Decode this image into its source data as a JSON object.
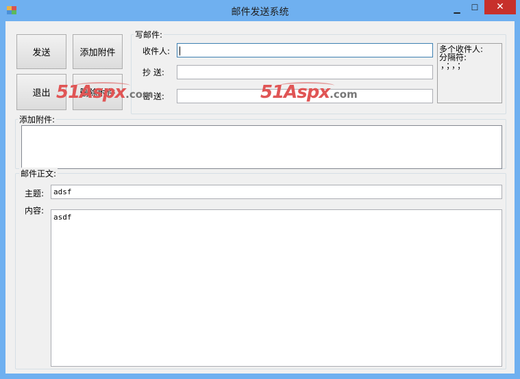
{
  "window": {
    "title": "邮件发送系统",
    "min_glyph": "▁",
    "max_glyph": "☐",
    "close_glyph": "✕"
  },
  "buttons": {
    "send": "发送",
    "add_attachment": "添加附件",
    "exit": "退出",
    "delete_attachment": "删除附件"
  },
  "compose": {
    "legend": "写邮件:",
    "to_label": "收件人:",
    "to_value": "",
    "cc_label": "抄 送:",
    "cc_value": "",
    "bcc_label": "密 送:",
    "bcc_value": "",
    "hint_line1": "多个收件人:",
    "hint_line2": "分隔符:",
    "hint_line3": "，；，；"
  },
  "attachments": {
    "legend": "添加附件:"
  },
  "body": {
    "legend": "邮件正文:",
    "subject_label": "主题:",
    "subject_value": "adsf",
    "content_label": "内容:",
    "content_value": "asdf"
  },
  "watermark": {
    "brand": "51Aspx",
    "suffix": ".com"
  }
}
